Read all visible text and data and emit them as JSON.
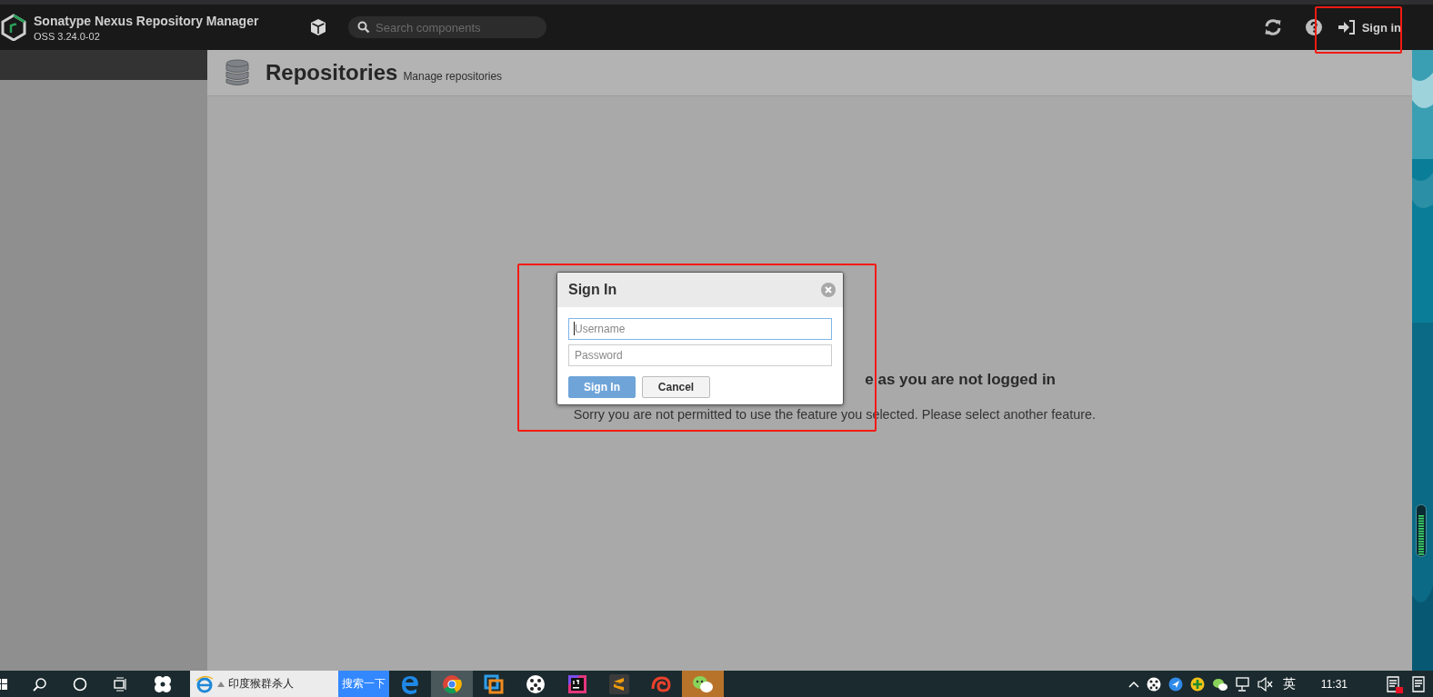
{
  "header": {
    "title": "Sonatype Nexus Repository Manager",
    "version": "OSS 3.24.0-02",
    "search": {
      "placeholder": "Search components"
    },
    "sign_in": "Sign in"
  },
  "page": {
    "title": "Repositories",
    "subtitle": "Manage repositories",
    "message_heading": "e as you are not logged in",
    "message": "Sorry you are not permitted to use the feature you selected. Please select another feature."
  },
  "dialog": {
    "title": "Sign In",
    "username": {
      "placeholder": "Username",
      "focused": true
    },
    "password": {
      "placeholder": "Password"
    },
    "buttons": [
      {
        "label": "Sign In",
        "kind": "primary"
      },
      {
        "label": "Cancel",
        "kind": "secondary"
      }
    ]
  },
  "taskbar": {
    "search": {
      "value": "印度猴群杀人",
      "button": "搜索一下"
    },
    "apps": [
      {
        "kind": "edge",
        "selected": false,
        "flashing": false
      },
      {
        "kind": "chrome",
        "selected": true,
        "flashing": false
      },
      {
        "kind": "squares",
        "selected": false,
        "flashing": false
      },
      {
        "kind": "dots",
        "selected": false,
        "flashing": false
      },
      {
        "kind": "ide",
        "selected": false,
        "flashing": false
      },
      {
        "kind": "editor",
        "selected": false,
        "flashing": false
      },
      {
        "kind": "spiral",
        "selected": false,
        "flashing": false
      },
      {
        "kind": "chat",
        "selected": false,
        "flashing": true
      }
    ],
    "tray": {
      "language": "英",
      "time": "11:31"
    }
  }
}
